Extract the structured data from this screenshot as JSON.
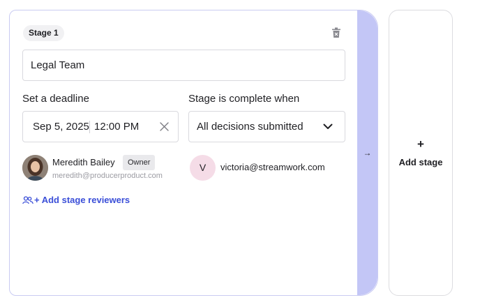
{
  "stage": {
    "badge": "Stage 1",
    "name_value": "Legal Team",
    "deadline_label": "Set a deadline",
    "date": "Sep 5, 2025",
    "time": "12:00 PM",
    "completion_label": "Stage is complete when",
    "completion_value": "All decisions submitted",
    "owner": {
      "name": "Meredith Bailey",
      "badge": "Owner",
      "email": "meredith@producerproduct.com"
    },
    "reviewer": {
      "initial": "V",
      "email": "victoria@streamwork.com"
    },
    "add_reviewers_label": "+ Add stage reviewers",
    "connector_arrow": "→"
  },
  "add_stage": {
    "plus": "+",
    "label": "Add stage"
  },
  "colors": {
    "accent": "#3b4fd8",
    "connector": "#c3c6f6",
    "card_border": "#c9cbf2",
    "letter_avatar_bg": "#f5dce7"
  },
  "icons": {
    "trash": "trash-icon",
    "clear": "close-icon",
    "dropdown": "chevron-down-icon",
    "add_reviewers": "add-people-icon",
    "connector": "arrow-right-icon"
  }
}
